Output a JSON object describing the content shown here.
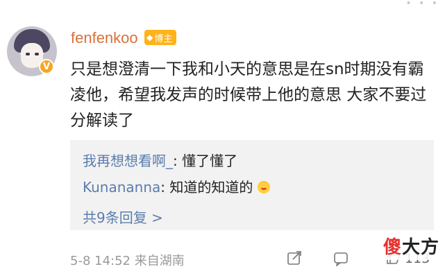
{
  "top_dots": "• • •",
  "user": {
    "username": "fenfenkoo",
    "badge_label": "博主",
    "badge_icon": "medal-icon",
    "verified_mark": "V"
  },
  "post": {
    "text": "只是想澄清一下我和小天的意思是在sn时期没有霸凌他，希望我发声的时候带上他的意思 大家不要过分解读了"
  },
  "replies": [
    {
      "name": "我再想想看啊_",
      "text": ": 懂了懂了"
    },
    {
      "name": "Kunananna",
      "text": ": 知道的知道的"
    }
  ],
  "more_replies": "共9条回复 >",
  "footer": {
    "meta": "5-8 14:52  来自湖南",
    "like_count": "113",
    "icons": [
      "share-icon",
      "comment-icon",
      "like-icon"
    ]
  },
  "watermark": {
    "first": "傻",
    "rest": "大方"
  },
  "colors": {
    "username": "#d9703a",
    "link": "#5a7dad",
    "badge": "#ffb21a",
    "reply_bg": "#f2f2f2",
    "watermark_first": "#e3322f"
  }
}
